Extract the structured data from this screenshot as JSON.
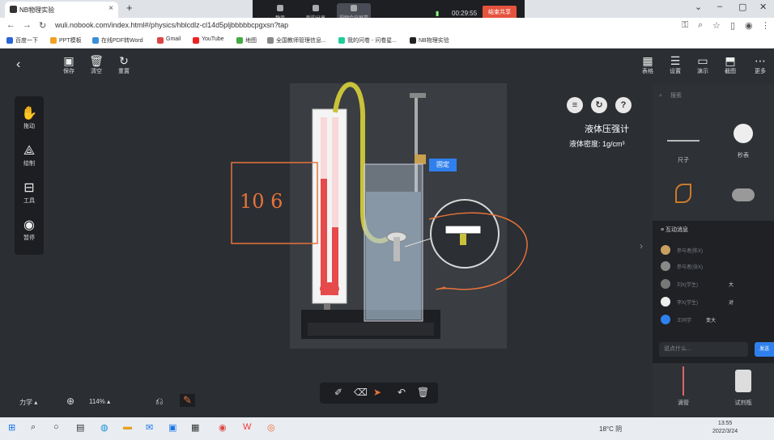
{
  "browser": {
    "tab_title": "NB物理实验",
    "url": "wuli.nobook.com/index.html#/physics/hblcdlz-cl14d5pljbbbbbcpgxsn?tap",
    "bookmarks": [
      "百度一下",
      "PPT模板",
      "在线PDF转Word",
      "Gmail",
      "YouTube",
      "地图",
      "全国教师管理信息...",
      "我的问卷 - 问卷星...",
      "NB物理实验"
    ]
  },
  "meeting": {
    "mute": "静音",
    "stop_video": "新的分享",
    "share": "视频会议屏幕",
    "timer": "00:29:55",
    "end_share": "结束共享"
  },
  "toolbar": {
    "save": "保存",
    "clear": "清空",
    "reset": "重置",
    "table": "表格",
    "settings": "设置",
    "demo": "演示",
    "screenshot": "截图",
    "more": "更多"
  },
  "leftrail": {
    "drag": "拖动",
    "draw": "绘制",
    "tools": "工具",
    "pause": "暂停"
  },
  "experiment": {
    "title": "液体压强计",
    "density": "液体密度: 1g/cm³",
    "fix_label": "固定",
    "handwriting": "10 6"
  },
  "rightpanel": {
    "search_placeholder": "搜索",
    "items": [
      "尺子",
      "秒表",
      "",
      "",
      "滴管",
      "试剂瓶"
    ]
  },
  "chat": {
    "header": "互动消息",
    "messages": [
      {
        "who": "参与者(陈X)",
        "text": ""
      },
      {
        "who": "参与者(张X)",
        "text": ""
      },
      {
        "who": "刘X(学生)",
        "text": "大"
      },
      {
        "who": "李X(学生)",
        "text": "对"
      },
      {
        "who": "王同学",
        "text": "变大"
      }
    ],
    "input_placeholder": "说点什么...",
    "send": "发送"
  },
  "bottom": {
    "subject": "力学",
    "zoom": "114%"
  },
  "taskbar": {
    "weather": "18°C 阴",
    "time": "13:55",
    "date": "2022/3/24"
  },
  "colors": {
    "accent": "#2f80ed",
    "end_share": "#e5533d",
    "annotation": "#e8733a"
  }
}
